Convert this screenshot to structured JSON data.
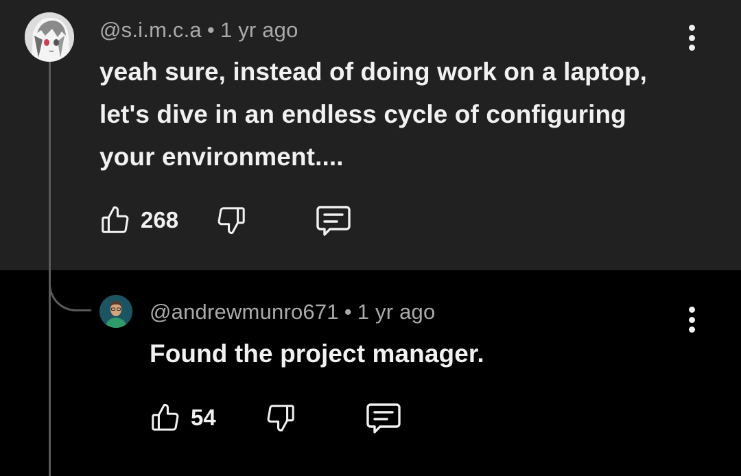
{
  "comments": [
    {
      "author": "@s.i.m.c.a",
      "time": "1 yr ago",
      "text": "yeah sure, instead of doing work on a laptop, let's dive in an endless cycle of configuring your environment....",
      "likes": "268"
    },
    {
      "author": "@andrewmunro671",
      "time": "1 yr ago",
      "text": "Found the project manager.",
      "likes": "54"
    }
  ],
  "separator": "•",
  "icons": {
    "like": "thumbs-up-icon",
    "dislike": "thumbs-down-icon",
    "reply": "comment-icon",
    "more": "more-vertical-icon"
  }
}
